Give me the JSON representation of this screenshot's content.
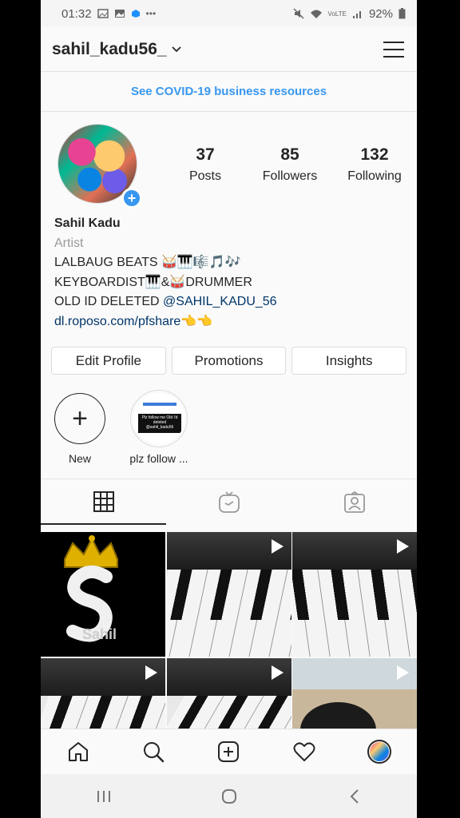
{
  "status_bar": {
    "time": "01:32",
    "battery": "92%",
    "signal_label": "VoLTE"
  },
  "header": {
    "username": "sahil_kadu56_",
    "chevron": "⌄"
  },
  "banner": {
    "text": "See COVID-19 business resources"
  },
  "profile": {
    "stats": [
      {
        "value": "37",
        "label": "Posts"
      },
      {
        "value": "85",
        "label": "Followers"
      },
      {
        "value": "132",
        "label": "Following"
      }
    ],
    "name": "Sahil Kadu",
    "category": "Artist",
    "bio_line1": "LALBAUG BEATS 🥁🎹🎼🎵🎶",
    "bio_line2": "KEYBOARDIST🎹&🥁DRUMMER",
    "bio_line3_prefix": "OLD ID DELETED ",
    "bio_line3_mention": "@SAHIL_KADU_56",
    "link": "dl.roposo.com/pfshare👈👈"
  },
  "buttons": {
    "edit_profile": "Edit Profile",
    "promotions": "Promotions",
    "insights": "Insights"
  },
  "highlights": [
    {
      "label": "New"
    },
    {
      "label": "plz follow ..."
    }
  ],
  "highlight_story_text": "Plz follow me Old i'd deleted @sahil_kadu56",
  "logo_text": "Sahil",
  "tabs": [
    "grid-icon",
    "igtv-icon",
    "tagged-icon"
  ],
  "nav": [
    "home-icon",
    "search-icon",
    "add-post-icon",
    "heart-icon",
    "profile-avatar"
  ],
  "colors": {
    "accent": "#3897f0",
    "text": "#262626",
    "muted": "#999999"
  }
}
